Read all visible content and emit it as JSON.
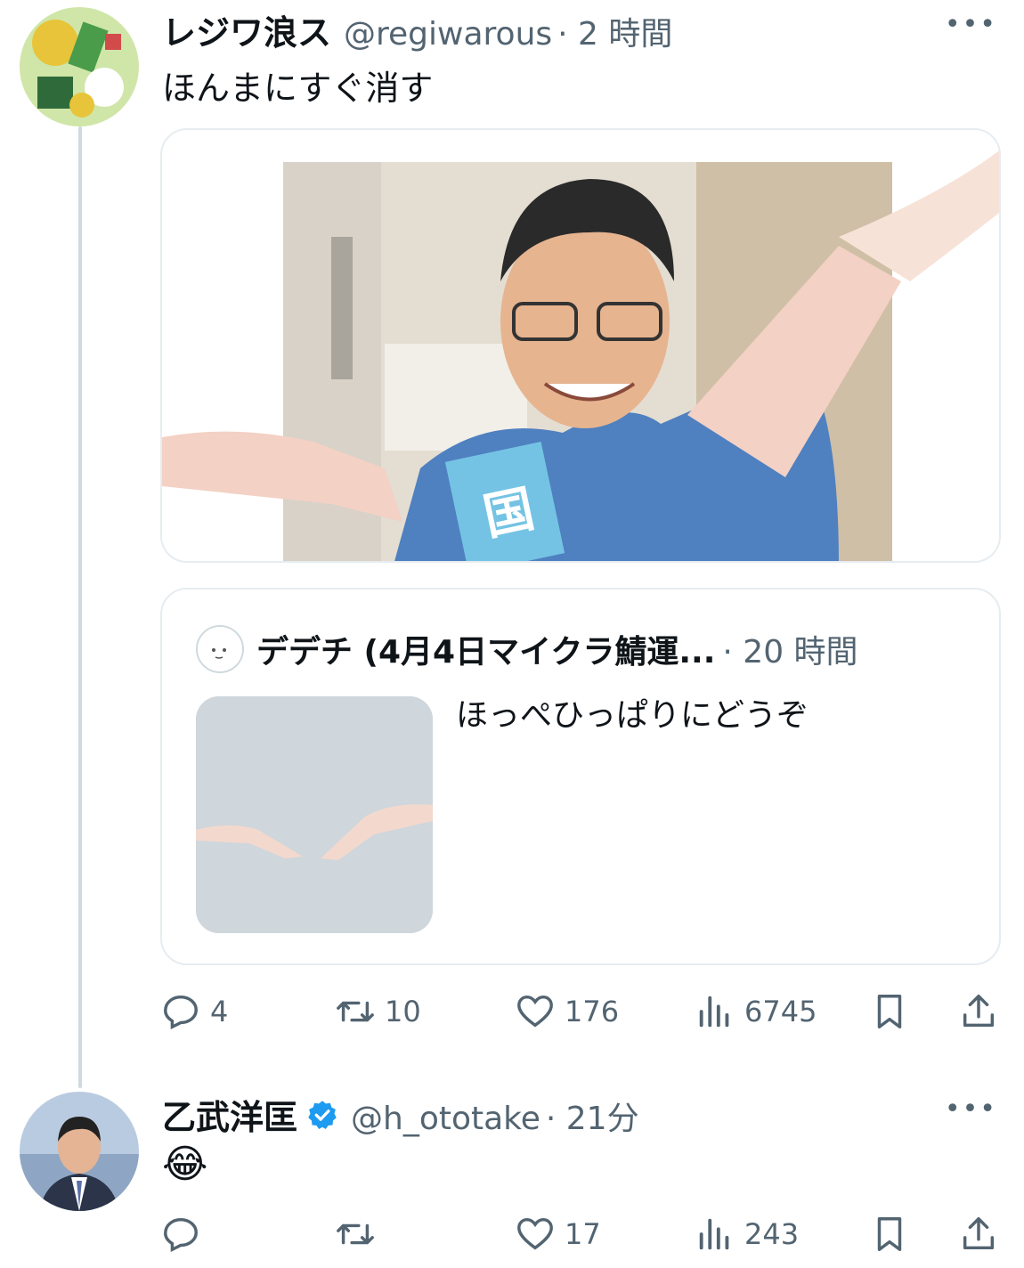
{
  "tweet1": {
    "display_name": "レジワ浪ス",
    "handle": "@regiwarous",
    "time": "· 2 時間",
    "more": "•••",
    "text": "ほんまにすぐ消す",
    "quote": {
      "display_name": "デデチ (4月4日マイクラ鯖運...",
      "time": "· 20 時間",
      "text": "ほっぺひっぱりにどうぞ"
    },
    "stats": {
      "replies": "4",
      "retweets": "10",
      "likes": "176",
      "views": "6745"
    }
  },
  "tweet2": {
    "display_name": "乙武洋匡",
    "verified": true,
    "handle": "@h_ototake",
    "time": "· 21分",
    "more": "•••",
    "text": "😂",
    "stats": {
      "replies": "",
      "retweets": "",
      "likes": "17",
      "views": "243"
    }
  },
  "colors": {
    "text_primary": "#0f1419",
    "text_secondary": "#536471",
    "border": "#e6ecf0",
    "verified_blue": "#1d9bf0",
    "thread_line": "#cfd9de"
  },
  "icons": [
    "reply-icon",
    "retweet-icon",
    "like-icon",
    "views-icon",
    "bookmark-icon",
    "share-icon",
    "more-icon",
    "verified-icon"
  ]
}
